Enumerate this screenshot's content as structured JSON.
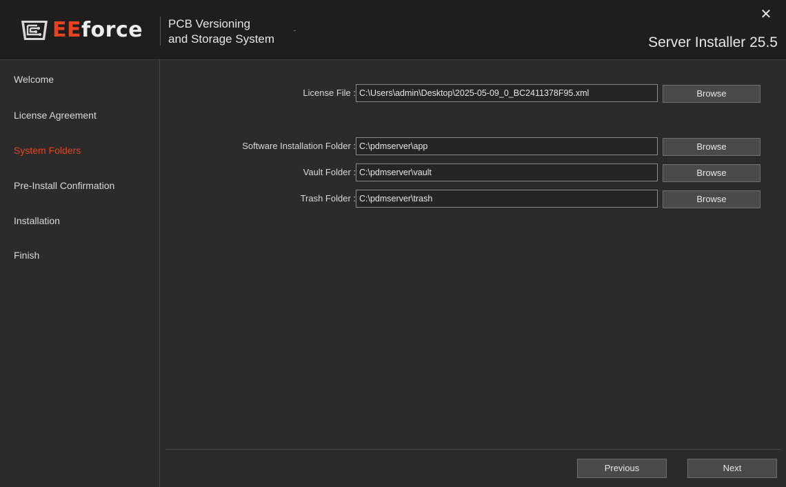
{
  "header": {
    "logo_ee": "EE",
    "logo_force": "force",
    "subtitle_line1": "PCB Versioning",
    "subtitle_line2": "and Storage System",
    "installer_title": "Server Installer 25.5",
    "close_icon": "close-icon",
    "close_label": "✕"
  },
  "sidebar": {
    "steps": [
      {
        "label": "Welcome",
        "active": false
      },
      {
        "label": "License Agreement",
        "active": false
      },
      {
        "label": "System Folders",
        "active": true
      },
      {
        "label": "Pre-Install Confirmation",
        "active": false
      },
      {
        "label": "Installation",
        "active": false
      },
      {
        "label": "Finish",
        "active": false
      }
    ]
  },
  "form": {
    "license": {
      "label": "License File :",
      "value": "C:\\Users\\admin\\Desktop\\2025-05-09_0_BC2411378F95.xml",
      "browse": "Browse"
    },
    "software": {
      "label": "Software Installation Folder :",
      "value": "C:\\pdmserver\\app",
      "browse": "Browse"
    },
    "vault": {
      "label": "Vault Folder :",
      "value": "C:\\pdmserver\\vault",
      "browse": "Browse"
    },
    "trash": {
      "label": "Trash Folder :",
      "value": "C:\\pdmserver\\trash",
      "browse": "Browse"
    }
  },
  "footer": {
    "previous": "Previous",
    "next": "Next"
  },
  "colors": {
    "accent": "#e8431f",
    "background": "#2b2b2b",
    "header": "#1e1e1e",
    "button": "#4a4a4a"
  }
}
